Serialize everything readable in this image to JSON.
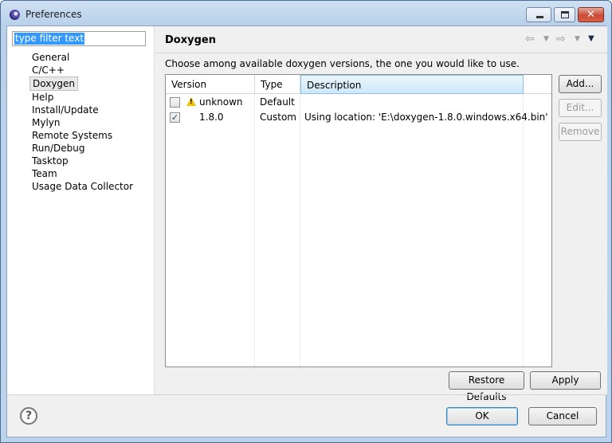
{
  "window": {
    "title": "Preferences"
  },
  "sidebar": {
    "filter_text": "type filter text",
    "items": [
      {
        "label": "General"
      },
      {
        "label": "C/C++"
      },
      {
        "label": "Doxygen",
        "selected": true
      },
      {
        "label": "Help"
      },
      {
        "label": "Install/Update"
      },
      {
        "label": "Mylyn"
      },
      {
        "label": "Remote Systems"
      },
      {
        "label": "Run/Debug"
      },
      {
        "label": "Tasktop"
      },
      {
        "label": "Team"
      },
      {
        "label": "Usage Data Collector"
      }
    ]
  },
  "page": {
    "title": "Doxygen",
    "description": "Choose among available doxygen versions, the one you would like to use.",
    "table": {
      "columns": [
        "Version",
        "Type",
        "Description"
      ],
      "rows": [
        {
          "checked": false,
          "warning": true,
          "version": "unknown",
          "type": "Default",
          "description": ""
        },
        {
          "checked": true,
          "warning": false,
          "version": "1.8.0",
          "type": "Custom",
          "description": "Using location: 'E:\\doxygen-1.8.0.windows.x64.bin'"
        }
      ]
    },
    "buttons": {
      "add": "Add...",
      "edit": "Edit...",
      "remove": "Remove"
    },
    "restore_defaults": "Restore Defaults",
    "apply": "Apply"
  },
  "footer": {
    "help": "?",
    "ok": "OK",
    "cancel": "Cancel"
  },
  "icons": {
    "nav_back": "back-arrow-icon",
    "nav_forward": "forward-arrow-icon",
    "view_menu": "view-menu-icon",
    "warning": "warning-icon",
    "help": "help-icon"
  },
  "colors": {
    "selection": "#3399ff",
    "window_frame": "#bcd3ec",
    "close_button": "#c94a35"
  }
}
